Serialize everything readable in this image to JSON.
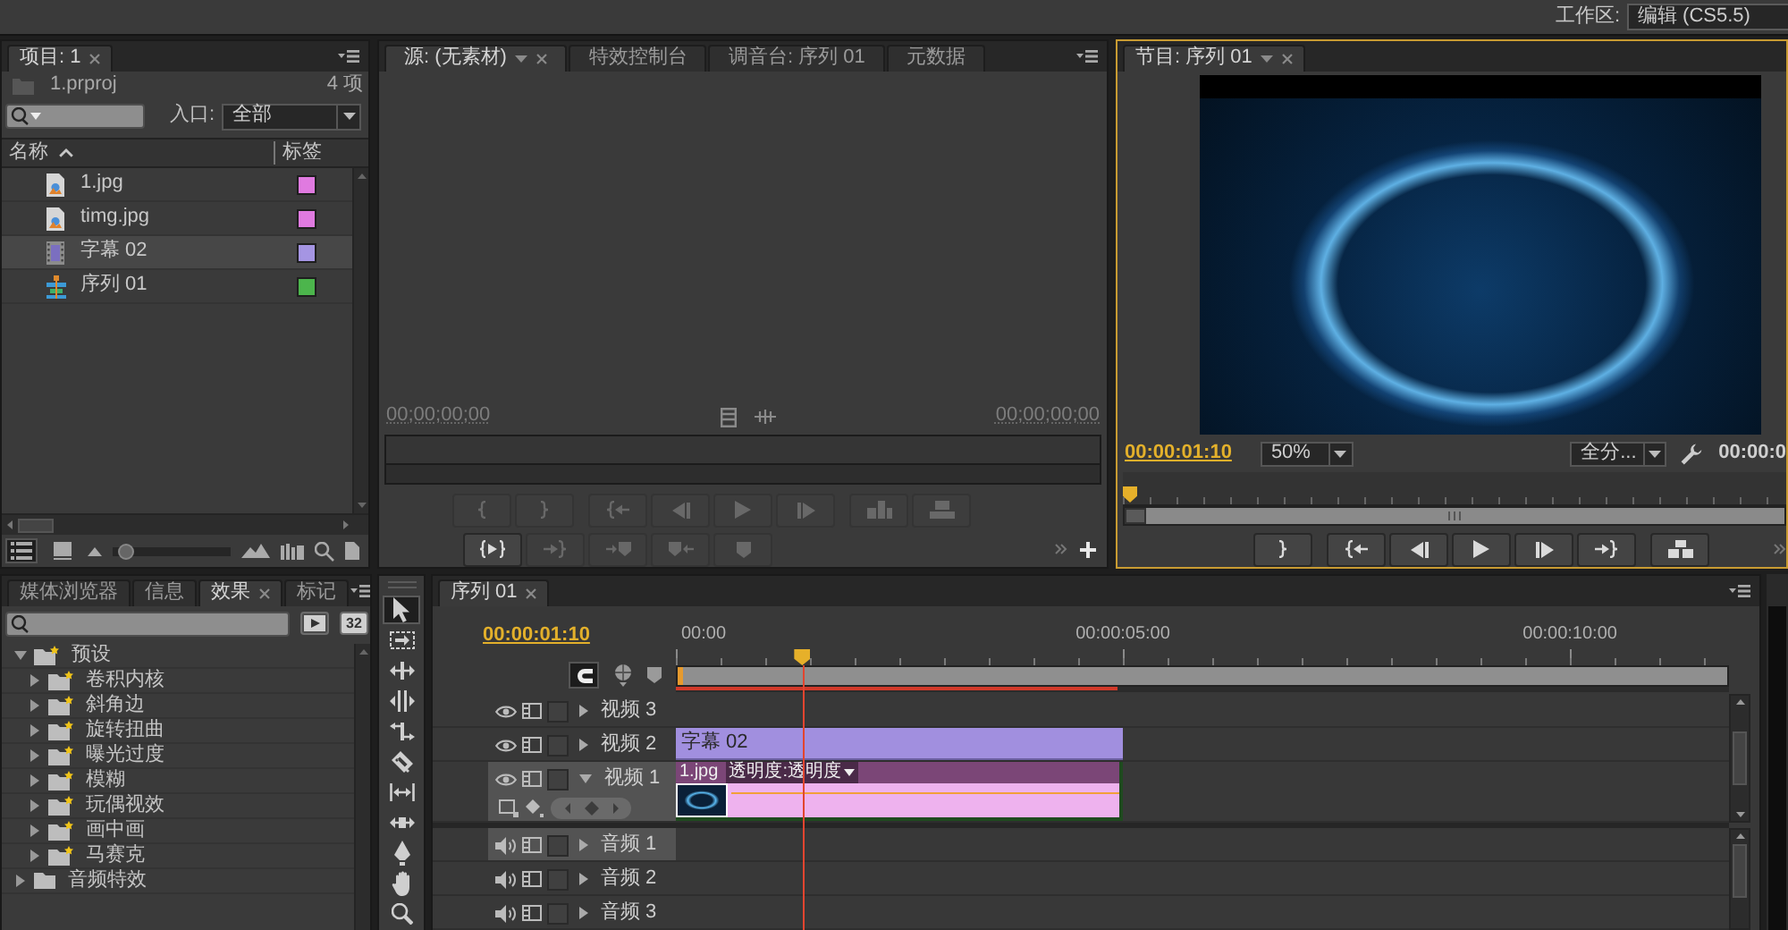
{
  "workspace": {
    "label": "工作区:",
    "value": "编辑 (CS5.5)"
  },
  "project_panel": {
    "focused": false,
    "tabs": [
      {
        "label": "项目: 1",
        "selected": true,
        "dropdown": false
      }
    ],
    "file": "1.prproj",
    "count": "4 项",
    "in_point": {
      "label": "入口:",
      "value": "全部"
    },
    "columns": [
      "名称",
      "标签"
    ],
    "items": [
      {
        "name": "1.jpg",
        "kind": "image",
        "color": "#e07ae0",
        "selected": false
      },
      {
        "name": "timg.jpg",
        "kind": "image",
        "color": "#e07ae0",
        "selected": false
      },
      {
        "name": "字幕 02",
        "kind": "title",
        "color": "#a595e3",
        "selected": true
      },
      {
        "name": "序列 01",
        "kind": "sequence",
        "color": "#4cb54c",
        "selected": false
      }
    ],
    "views": [
      {
        "kind": "list",
        "selected": true
      },
      {
        "kind": "icon",
        "selected": false
      }
    ],
    "icon_size": {
      "level": 0.05
    }
  },
  "source_panel": {
    "focused": false,
    "tabs": [
      {
        "label": "源: (无素材)",
        "selected": true,
        "dropdown": true
      },
      {
        "label": "特效控制台",
        "selected": false,
        "dropdown": false
      },
      {
        "label": "调音台: 序列 01",
        "selected": false,
        "dropdown": false
      },
      {
        "label": "元数据",
        "selected": false,
        "dropdown": false
      }
    ],
    "timecode_in": "00;00;00;00",
    "timecode_out": "00;00;00;00",
    "transport": [
      [
        {
          "kind": "mark-in",
          "disabled": true
        },
        {
          "kind": "mark-out",
          "disabled": true
        },
        {
          "kind": "go-to-in",
          "disabled": true
        },
        {
          "kind": "step-back",
          "disabled": true
        },
        {
          "kind": "play",
          "disabled": true
        },
        {
          "kind": "step-forward",
          "disabled": true
        },
        {
          "kind": "insert",
          "disabled": true
        },
        {
          "kind": "overwrite",
          "disabled": true
        }
      ],
      [
        {
          "kind": "play-in-to-out",
          "disabled": false
        },
        {
          "kind": "go-to-out",
          "disabled": true
        },
        {
          "kind": "arrow-marker",
          "disabled": true
        },
        {
          "kind": "marker-arrow",
          "disabled": true
        },
        {
          "kind": "marker",
          "disabled": true
        }
      ]
    ]
  },
  "program_panel": {
    "focused": true,
    "tabs": [
      {
        "label": "节目: 序列 01",
        "selected": true,
        "dropdown": true
      }
    ],
    "timecode": "00:00:01:10",
    "zoom": "50%",
    "quality": "全分...",
    "duration": "00:00:0",
    "playhead": {
      "level": 0
    },
    "transport": [
      [
        {
          "kind": "mark-out",
          "disabled": false
        },
        {
          "kind": "go-to-in",
          "disabled": false
        },
        {
          "kind": "step-back",
          "disabled": false
        },
        {
          "kind": "play",
          "disabled": false
        },
        {
          "kind": "step-forward",
          "disabled": false
        },
        {
          "kind": "go-to-out",
          "disabled": false
        },
        {
          "kind": "lift",
          "disabled": false
        }
      ]
    ]
  },
  "effects_panel": {
    "focused": false,
    "tabs": [
      {
        "label": "媒体浏览器",
        "selected": false,
        "dropdown": false
      },
      {
        "label": "信息",
        "selected": false,
        "dropdown": false
      },
      {
        "label": "效果",
        "selected": true,
        "dropdown": false
      },
      {
        "label": "标记",
        "selected": false,
        "dropdown": false
      }
    ],
    "badge": "32",
    "tree": [
      {
        "label": "预设",
        "kind": "preset",
        "expanded": true,
        "children": [
          {
            "label": "卷积内核",
            "kind": "preset",
            "expanded": false
          },
          {
            "label": "斜角边",
            "kind": "preset",
            "expanded": false
          },
          {
            "label": "旋转扭曲",
            "kind": "preset",
            "expanded": false
          },
          {
            "label": "曝光过度",
            "kind": "preset",
            "expanded": false
          },
          {
            "label": "模糊",
            "kind": "preset",
            "expanded": false
          },
          {
            "label": "玩偶视效",
            "kind": "preset",
            "expanded": false
          },
          {
            "label": "画中画",
            "kind": "preset",
            "expanded": false
          },
          {
            "label": "马赛克",
            "kind": "preset",
            "expanded": false
          }
        ]
      },
      {
        "label": "音频特效",
        "kind": "effect",
        "expanded": false
      }
    ]
  },
  "tools": [
    {
      "kind": "selection",
      "selected": true
    },
    {
      "kind": "track-select",
      "selected": false
    },
    {
      "kind": "ripple",
      "selected": false
    },
    {
      "kind": "rolling",
      "selected": false
    },
    {
      "kind": "rate-stretch",
      "selected": false
    },
    {
      "kind": "razor",
      "selected": false
    },
    {
      "kind": "slip",
      "selected": false
    },
    {
      "kind": "slide",
      "selected": false
    },
    {
      "kind": "pen",
      "selected": false
    },
    {
      "kind": "hand",
      "selected": false
    },
    {
      "kind": "zoom",
      "selected": false
    }
  ],
  "timeline": {
    "focused": false,
    "tabs": [
      {
        "label": "序列 01",
        "selected": true,
        "dropdown": false
      }
    ],
    "timecode": "00:00:01:10",
    "snap": {
      "on": true
    },
    "ruler": [
      "00:00",
      "00:00:05:00",
      "00:00:10:00"
    ],
    "playhead": {
      "level": 0.12
    },
    "render_bar": {
      "level": 0.42
    },
    "tracks": [
      {
        "name": "视频 3",
        "kind": "video",
        "expanded": false,
        "targeted": false
      },
      {
        "name": "视频 2",
        "kind": "video",
        "expanded": false,
        "targeted": false,
        "clips": [
          {
            "label": "字幕 02",
            "kind": "title"
          }
        ]
      },
      {
        "name": "视频 1",
        "kind": "video",
        "expanded": true,
        "targeted": true,
        "clips": [
          {
            "label": "1.jpg",
            "kind": "image",
            "effect": "透明度:透明度"
          }
        ]
      },
      {
        "name": "音频 1",
        "kind": "audio",
        "expanded": false,
        "targeted": true
      },
      {
        "name": "音频 2",
        "kind": "audio",
        "expanded": false,
        "targeted": false
      },
      {
        "name": "音频 3",
        "kind": "audio",
        "expanded": false,
        "targeted": false
      }
    ]
  }
}
